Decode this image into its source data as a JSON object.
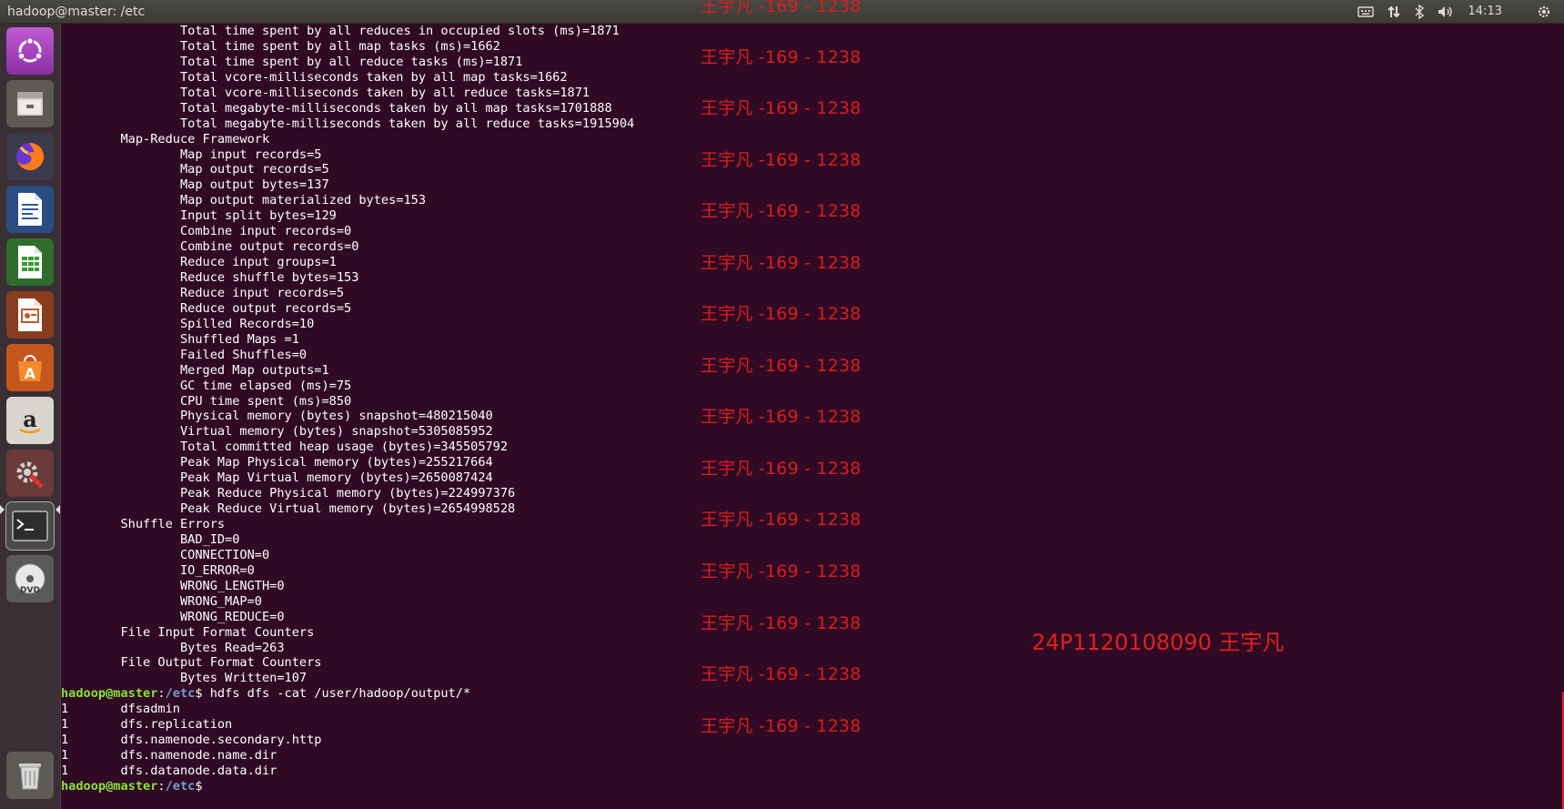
{
  "window": {
    "title": "hadoop@master: /etc"
  },
  "panel": {
    "clock": "14:13"
  },
  "launcher": {
    "items": [
      {
        "name": "ubuntu-dash"
      },
      {
        "name": "files"
      },
      {
        "name": "firefox"
      },
      {
        "name": "libreoffice-writer"
      },
      {
        "name": "libreoffice-calc"
      },
      {
        "name": "libreoffice-impress"
      },
      {
        "name": "ubuntu-software"
      },
      {
        "name": "amazon"
      },
      {
        "name": "system-settings"
      },
      {
        "name": "terminal"
      },
      {
        "name": "dvd"
      },
      {
        "name": "trash"
      }
    ]
  },
  "terminal": {
    "lines": [
      "\t\tTotal time spent by all reduces in occupied slots (ms)=1871",
      "\t\tTotal time spent by all map tasks (ms)=1662",
      "\t\tTotal time spent by all reduce tasks (ms)=1871",
      "\t\tTotal vcore-milliseconds taken by all map tasks=1662",
      "\t\tTotal vcore-milliseconds taken by all reduce tasks=1871",
      "\t\tTotal megabyte-milliseconds taken by all map tasks=1701888",
      "\t\tTotal megabyte-milliseconds taken by all reduce tasks=1915904",
      "\tMap-Reduce Framework",
      "\t\tMap input records=5",
      "\t\tMap output records=5",
      "\t\tMap output bytes=137",
      "\t\tMap output materialized bytes=153",
      "\t\tInput split bytes=129",
      "\t\tCombine input records=0",
      "\t\tCombine output records=0",
      "\t\tReduce input groups=1",
      "\t\tReduce shuffle bytes=153",
      "\t\tReduce input records=5",
      "\t\tReduce output records=5",
      "\t\tSpilled Records=10",
      "\t\tShuffled Maps =1",
      "\t\tFailed Shuffles=0",
      "\t\tMerged Map outputs=1",
      "\t\tGC time elapsed (ms)=75",
      "\t\tCPU time spent (ms)=850",
      "\t\tPhysical memory (bytes) snapshot=480215040",
      "\t\tVirtual memory (bytes) snapshot=5305085952",
      "\t\tTotal committed heap usage (bytes)=345505792",
      "\t\tPeak Map Physical memory (bytes)=255217664",
      "\t\tPeak Map Virtual memory (bytes)=2650087424",
      "\t\tPeak Reduce Physical memory (bytes)=224997376",
      "\t\tPeak Reduce Virtual memory (bytes)=2654998528",
      "\tShuffle Errors",
      "\t\tBAD_ID=0",
      "\t\tCONNECTION=0",
      "\t\tIO_ERROR=0",
      "\t\tWRONG_LENGTH=0",
      "\t\tWRONG_MAP=0",
      "\t\tWRONG_REDUCE=0",
      "\tFile Input Format Counters ",
      "\t\tBytes Read=263",
      "\tFile Output Format Counters ",
      "\t\tBytes Written=107"
    ],
    "command_prompt": {
      "user": "hadoop@master",
      "sep": ":",
      "path": "/etc",
      "symbol": "$ ",
      "command": "hdfs dfs -cat /user/hadoop/output/*"
    },
    "output_lines": [
      "1\tdfsadmin",
      "1\tdfs.replication",
      "1\tdfs.namenode.secondary.http",
      "1\tdfs.namenode.name.dir",
      "1\tdfs.datanode.data.dir"
    ],
    "final_prompt": {
      "user": "hadoop@master",
      "sep": ":",
      "path": "/etc",
      "symbol": "$"
    }
  },
  "watermarks": {
    "text": "王宇凡 -169 - 1238",
    "student_id": "24P1120108090 王宇凡"
  }
}
